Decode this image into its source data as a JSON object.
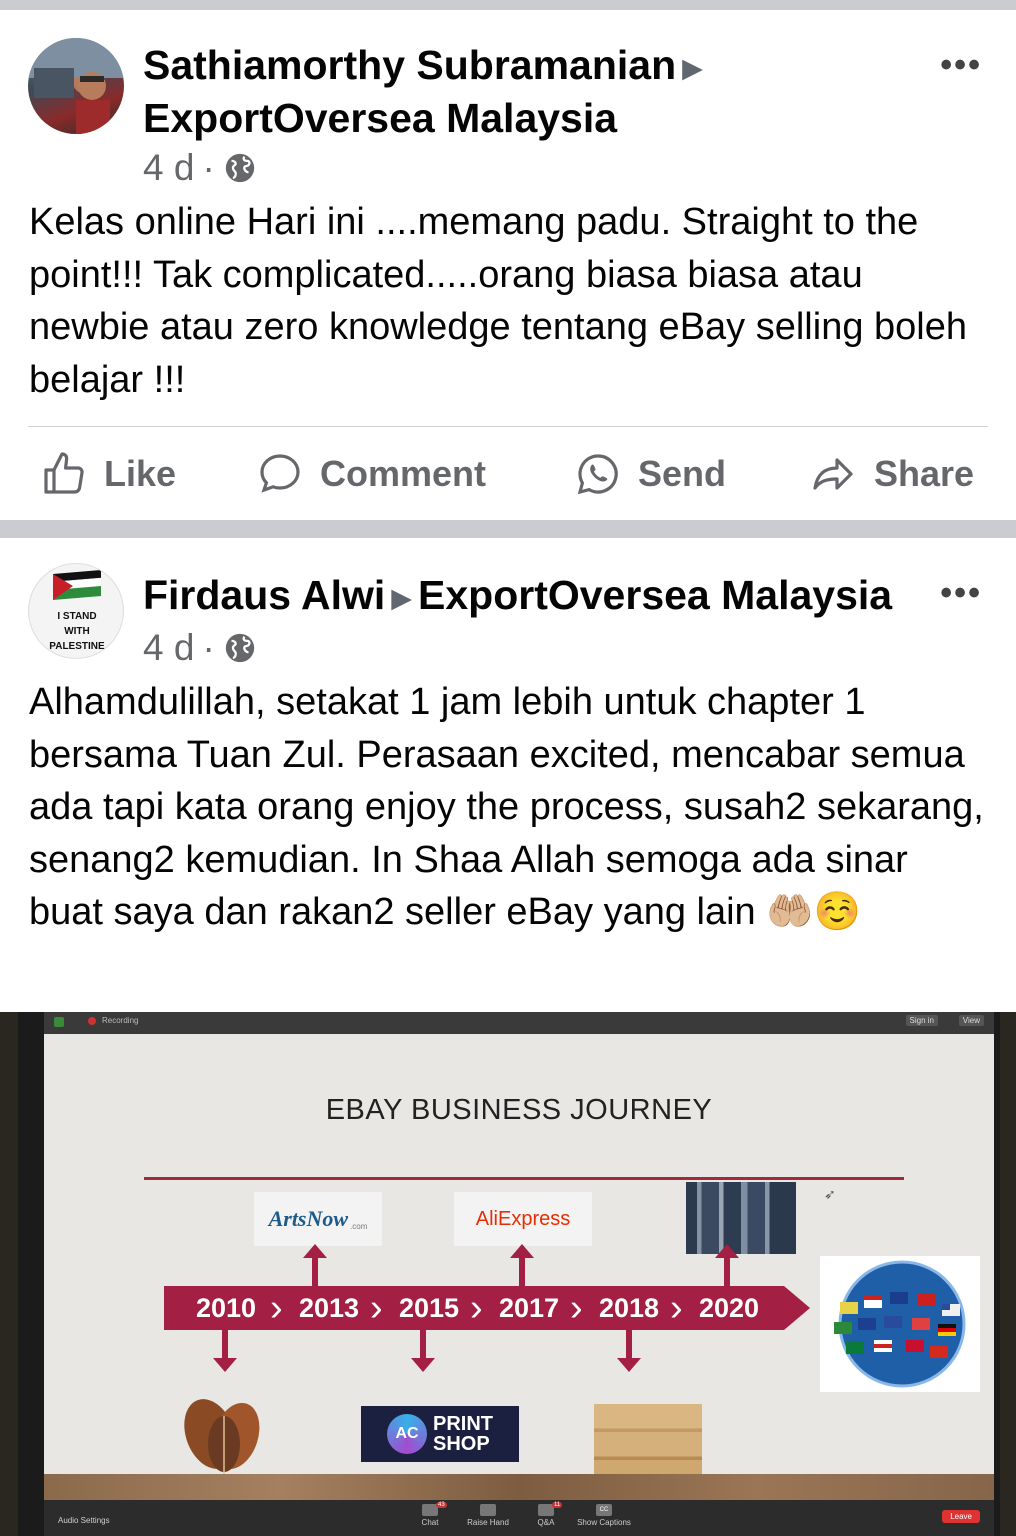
{
  "post1": {
    "author": "Sathiamorthy Subramanian",
    "group": "ExportOversea Malaysia",
    "time": "4 d",
    "dot": "·",
    "more": "•••",
    "text": "Kelas online Hari ini ....memang padu. Straight to the point!!! Tak complicated.....orang biasa biasa atau newbie atau zero knowledge tentang eBay selling boleh belajar !!!",
    "actions": {
      "like": "Like",
      "comment": "Comment",
      "send": "Send",
      "share": "Share"
    }
  },
  "post2": {
    "author": "Firdaus Alwi",
    "group": "ExportOversea Malaysia",
    "time": "4 d",
    "dot": "·",
    "more": "•••",
    "avatar_text": [
      "I STAND",
      "WITH",
      "PALESTINE"
    ],
    "text": "Alhamdulillah, setakat 1 jam lebih untuk chapter 1 bersama Tuan Zul. Perasaan excited, mencabar semua ada tapi kata orang enjoy the process, susah2 sekarang, senang2 kemudian. In Shaa Allah semoga ada sinar buat saya dan rakan2 seller eBay yang lain 🤲🏼☺️",
    "photo": {
      "recording": "Recording",
      "sign_in": "Sign in",
      "view": "View",
      "slide_title": "EBAY BUSINESS JOURNEY",
      "years": [
        "2010",
        "2013",
        "2015",
        "2017",
        "2018",
        "2020"
      ],
      "artsnow": "ArtsNow",
      "artsnow_sub": ".com",
      "aliexpress": "AliExpress",
      "printshop_badge": "AC",
      "printshop_line1": "PRINT",
      "printshop_line2": "SHOP",
      "zoom_bar": {
        "audio": "Audio Settings",
        "chat": "Chat",
        "chat_count": "43",
        "raise_hand": "Raise Hand",
        "qa": "Q&A",
        "qa_count": "11",
        "captions": "Show Captions",
        "cc": "CC",
        "leave": "Leave"
      }
    }
  },
  "colors": {
    "text": "#050505",
    "secondary": "#65676b",
    "divider": "#ced0d4",
    "feed_bg": "#c9ccd1",
    "timeline": "#a31f44",
    "aliexpress": "#e62e04"
  }
}
